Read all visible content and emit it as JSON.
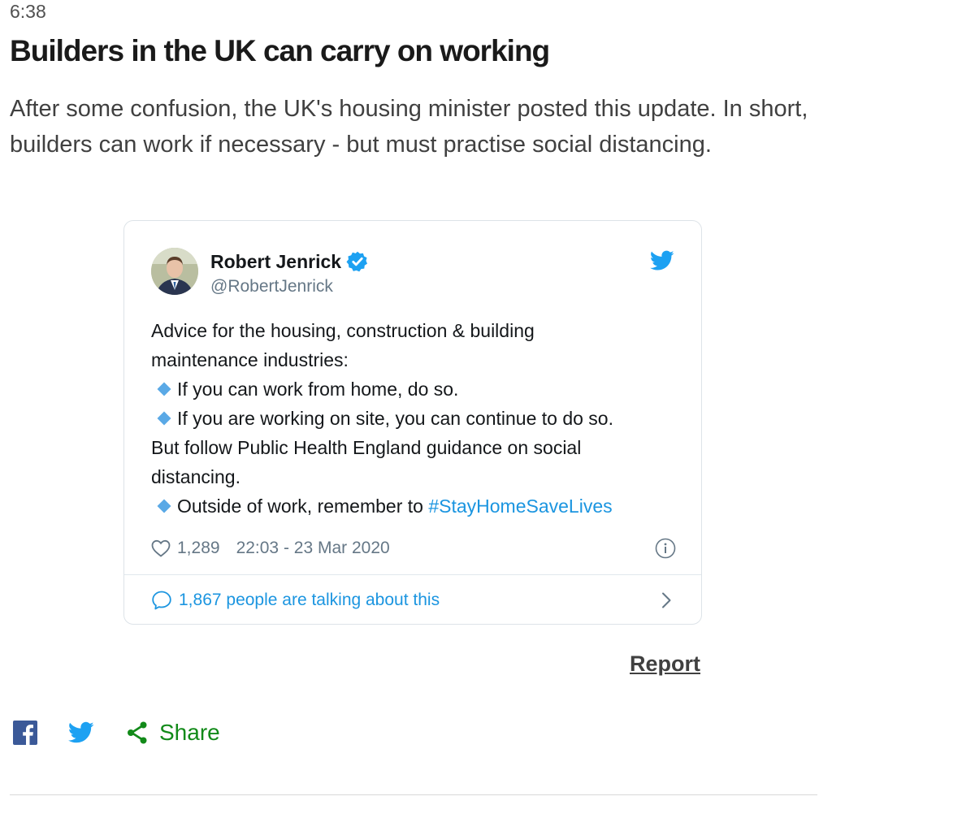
{
  "post": {
    "time": "6:38",
    "headline": "Builders in the UK can carry on working",
    "intro": "After some confusion, the UK's housing minister posted this update. In short, builders can work if necessary - but must practise social distancing."
  },
  "tweet": {
    "author_name": "Robert Jenrick",
    "author_handle": "@RobertJenrick",
    "lines": {
      "l1": "Advice for the housing, construction & building",
      "l2": "maintenance industries:",
      "l3": "If you can work from home, do so.",
      "l4": "If you are working on site, you can continue to do so.",
      "l5": "But follow Public Health England guidance on social",
      "l6": "distancing.",
      "l7": "Outside of work, remember to ",
      "hashtag": "#StayHomeSaveLives"
    },
    "likes": "1,289",
    "date": "22:03 - 23 Mar 2020",
    "talking": "1,867 people are talking about this"
  },
  "report_label": "Report",
  "share": {
    "label": "Share"
  },
  "colors": {
    "twitter_blue": "#1da1f2",
    "link_blue": "#1b95e0",
    "share_green": "#128a19",
    "facebook_blue": "#3b5998"
  },
  "icons": {
    "verified": "verified-badge-icon",
    "twitter": "twitter-bird-icon",
    "heart": "heart-icon",
    "info": "info-icon",
    "reply": "reply-bubble-icon",
    "chevron": "chevron-right-icon",
    "facebook": "facebook-icon",
    "share": "share-icon"
  }
}
